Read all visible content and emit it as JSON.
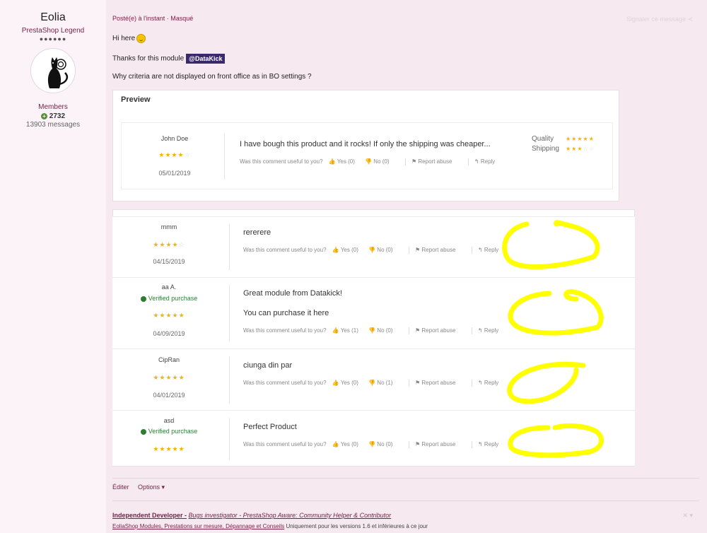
{
  "author": {
    "name": "Eolia",
    "rank": "PrestaShop Legend",
    "rank_dots": "●●●●●●",
    "group": "Members",
    "reputation": "2732",
    "messages": "13903 messages"
  },
  "post": {
    "meta": "Posté(e) à l'instant · Masqué",
    "share_label": "Signaler ce message",
    "line1": "Hi here",
    "line2": "Thanks for this module",
    "mention": "@DataKick",
    "line3": "Why criteria are not displayed on front office as in BO settings ?"
  },
  "preview": {
    "title": "Preview",
    "review": {
      "name": "John Doe",
      "rating": 4,
      "date": "05/01/2019",
      "text": "I have bough this product and it rocks! If only the shipping was cheaper...",
      "useful": "Was this comment useful to you?",
      "yes": "Yes (0)",
      "no": "No (0)",
      "report": "Report abuse",
      "reply": "Reply"
    },
    "criteria": [
      {
        "label": "Quality",
        "rating": 5
      },
      {
        "label": "Shipping",
        "rating": 3
      }
    ]
  },
  "reviews": [
    {
      "name": "mmm",
      "verified": "",
      "rating": 4,
      "date": "04/15/2019",
      "text": "rererere",
      "text2": "",
      "yes": "Yes (0)",
      "no": "No (0)"
    },
    {
      "name": "aa A.",
      "verified": "Verified purchase",
      "rating": 5,
      "date": "04/09/2019",
      "text": "Great module from Datakick!",
      "text2": "You can purchase it here",
      "yes": "Yes (1)",
      "no": "No (0)"
    },
    {
      "name": "CipRan",
      "verified": "",
      "rating": 5,
      "date": "04/01/2019",
      "text": "ciunga din par",
      "text2": "",
      "yes": "Yes (0)",
      "no": "No (1)"
    },
    {
      "name": "asd",
      "verified": "Verified purchase",
      "rating": 5,
      "date": "",
      "text": "Perfect Product",
      "text2": "",
      "yes": "Yes (0)",
      "no": "No (0)"
    }
  ],
  "review_labels": {
    "useful": "Was this comment useful to you?",
    "report": "Report abuse",
    "reply": "Reply"
  },
  "footer": {
    "edit": "Éditer",
    "options": "Options ▾",
    "sig_dev": "Independent Developer -",
    "sig_rest": "Bugs investigator - PrestaShop Aware: Community Helper & Contributor",
    "sig2_link": "EoliaShop Modules, Prestations sur mesure, Dépannage et Conseils",
    "sig2_text": "Uniquement pour les versions 1.6 et inférieures à ce jour"
  },
  "colors": {
    "accent": "#7a1e45",
    "stars": "#f2b600",
    "verified": "#2e7d32",
    "scribble": "#ffff00"
  }
}
